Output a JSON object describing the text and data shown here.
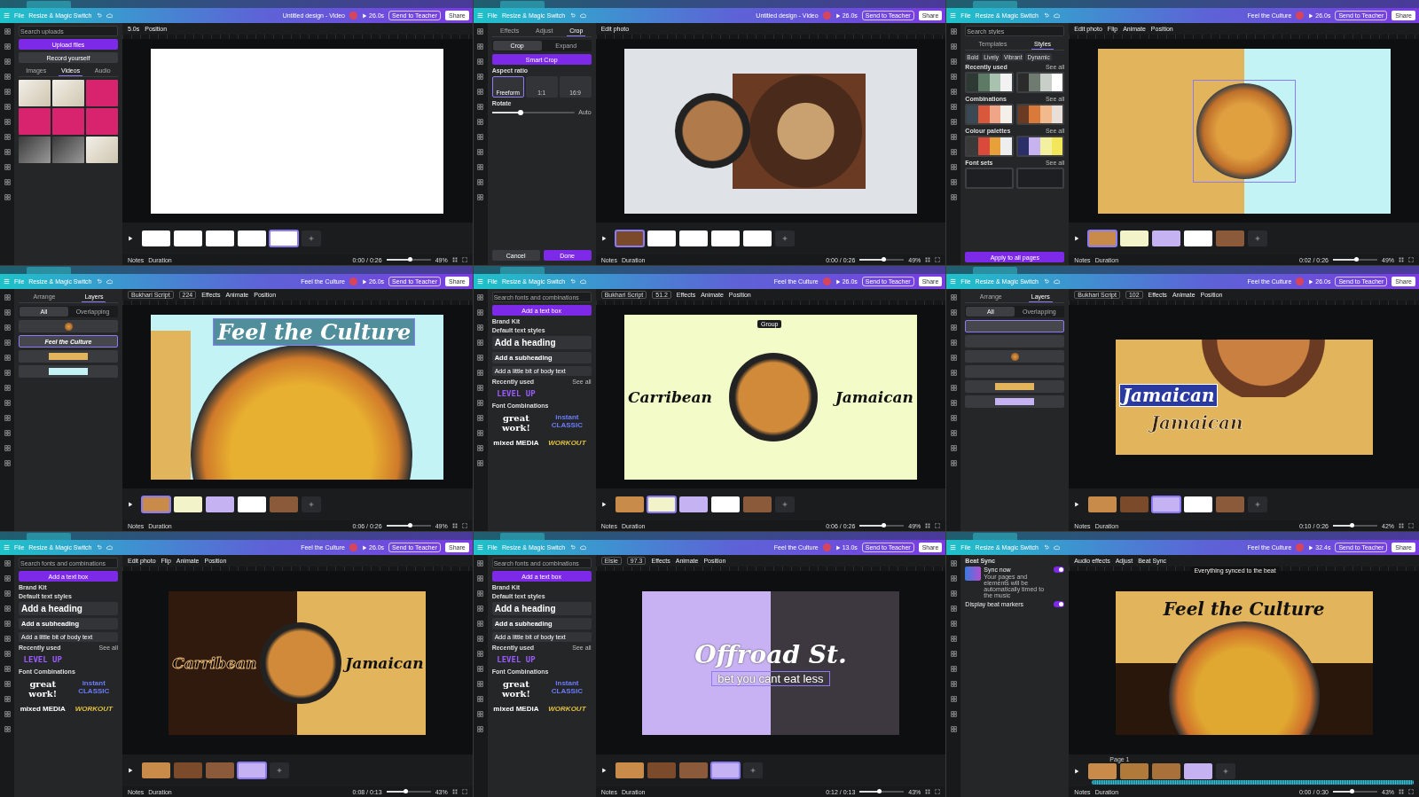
{
  "panels": [
    {
      "header": {
        "menu": "File",
        "resize": "Resize & Magic Switch",
        "title": "Untitled design - Video",
        "play": "26.0s",
        "teacher": "Send to Teacher",
        "share": "Share"
      },
      "toolbar": {
        "tools": [
          "5.0s",
          "Position"
        ]
      },
      "side": {
        "kind": "uploads",
        "placeholder": "Search uploads",
        "upload": "Upload files",
        "record": "Record yourself",
        "tabs": [
          {
            "label": "Images",
            "selected": false
          },
          {
            "label": "Videos",
            "selected": true
          },
          {
            "label": "Audio",
            "selected": false
          }
        ],
        "tiles": [
          {
            "kind": "photo"
          },
          {
            "kind": "photo"
          },
          {
            "kind": "pink"
          },
          {
            "kind": "pink"
          },
          {
            "kind": "pink"
          },
          {
            "kind": "pink"
          },
          {
            "kind": "dark"
          },
          {
            "kind": "dark"
          },
          {
            "kind": "photo"
          }
        ]
      },
      "canvas": {
        "kind": "blank",
        "bg": [
          {
            "color": "#ffffff"
          }
        ]
      },
      "thumbs": [
        {
          "color": "#ffffff",
          "selected": false
        },
        {
          "color": "#ffffff",
          "selected": false
        },
        {
          "color": "#ffffff",
          "selected": false
        },
        {
          "color": "#ffffff",
          "selected": false
        },
        {
          "color": "#ffffff",
          "selected": true
        }
      ],
      "footer": {
        "notes": "Notes",
        "duration": "Duration",
        "time": "0:00 / 0:26",
        "zoom": "49%",
        "level": 0.55
      }
    },
    {
      "header": {
        "menu": "File",
        "resize": "Resize & Magic Switch",
        "title": "Untitled design - Video",
        "play": "26.0s",
        "teacher": "Send to Teacher",
        "share": "Share"
      },
      "toolbar": {
        "tools": [
          "Edit photo"
        ]
      },
      "side": {
        "kind": "crop",
        "tabs": [
          {
            "label": "Effects",
            "selected": false
          },
          {
            "label": "Adjust",
            "selected": false
          },
          {
            "label": "Crop",
            "selected": true
          }
        ],
        "modes": [
          {
            "label": "Crop",
            "selected": true
          },
          {
            "label": "Expand",
            "selected": false
          }
        ],
        "smart": "Smart Crop",
        "aspect": "Aspect ratio",
        "ratios": [
          {
            "label": "Freeform",
            "selected": true
          },
          {
            "label": "1:1",
            "selected": false
          },
          {
            "label": "16:9",
            "selected": false
          }
        ],
        "rotate": "Rotate",
        "level": 0.35,
        "auto": "Auto",
        "cancel": "Cancel",
        "done": "Done"
      },
      "canvas": {
        "kind": "crop",
        "bg": [
          {
            "color": "#dfe2e7"
          }
        ]
      },
      "thumbs": [
        {
          "color": "#7a4a2a",
          "selected": true
        },
        {
          "color": "#ffffff",
          "selected": false
        },
        {
          "color": "#ffffff",
          "selected": false
        },
        {
          "color": "#ffffff",
          "selected": false
        },
        {
          "color": "#ffffff",
          "selected": false
        }
      ],
      "footer": {
        "notes": "Notes",
        "duration": "Duration",
        "time": "0:00 / 0:26",
        "zoom": "49%",
        "level": 0.55
      }
    },
    {
      "header": {
        "menu": "File",
        "resize": "Resize & Magic Switch",
        "title": "Feel the Culture",
        "play": "26.0s",
        "teacher": "Send to Teacher",
        "share": "Share"
      },
      "toolbar": {
        "tools": [
          "Edit photo",
          "Flip",
          "Animate",
          "Position"
        ]
      },
      "side": {
        "kind": "styles",
        "placeholder": "Search styles",
        "tabs": [
          {
            "label": "Templates",
            "selected": false
          },
          {
            "label": "Styles",
            "selected": true
          }
        ],
        "chips": [
          "Bold",
          "Lively",
          "Vibrant",
          "Dynamic"
        ],
        "sections": [
          {
            "title": "Recently used",
            "see": "See all",
            "cards": [
              {
                "stripes": [
                  {
                    "color": "#2d3a33"
                  },
                  {
                    "color": "#5c7a66"
                  },
                  {
                    "color": "#a9c2b0"
                  },
                  {
                    "color": "#f2f2f2"
                  }
                ]
              },
              {
                "stripes": [
                  {
                    "color": "#2b2b2b"
                  },
                  {
                    "color": "#6f7a70"
                  },
                  {
                    "color": "#c8cfc9"
                  },
                  {
                    "color": "#ffffff"
                  }
                ]
              }
            ]
          },
          {
            "title": "Combinations",
            "see": "See all",
            "cards": [
              {
                "stripes": [
                  {
                    "color": "#3a4a55"
                  },
                  {
                    "color": "#d9573b"
                  },
                  {
                    "color": "#f0a686"
                  },
                  {
                    "color": "#f4efe9"
                  }
                ]
              },
              {
                "stripes": [
                  {
                    "color": "#6b3a22"
                  },
                  {
                    "color": "#d97a3a"
                  },
                  {
                    "color": "#f2b98c"
                  },
                  {
                    "color": "#e8e0d8"
                  }
                ]
              }
            ]
          },
          {
            "title": "Colour palettes",
            "see": "See all",
            "cards": [
              {
                "stripes": [
                  {
                    "color": "#3a3a3a"
                  },
                  {
                    "color": "#d94a3a"
                  },
                  {
                    "color": "#e8a03a"
                  },
                  {
                    "color": "#eeeeee"
                  }
                ]
              },
              {
                "stripes": [
                  {
                    "color": "#2a2f6a"
                  },
                  {
                    "color": "#c6b3ef"
                  },
                  {
                    "color": "#f3f1a0"
                  },
                  {
                    "color": "#f2e65a"
                  }
                ]
              }
            ]
          },
          {
            "title": "Font sets",
            "see": "See all",
            "cards": [
              {
                "stripes": [
                  {
                    "color": "#1e1f22"
                  }
                ]
              },
              {
                "stripes": [
                  {
                    "color": "#1e1f22"
                  }
                ]
              }
            ]
          }
        ],
        "apply": "Apply to all pages"
      },
      "canvas": {
        "kind": "split",
        "bg": [
          {
            "color": "#e2b55c"
          },
          {
            "color": "#c3f3f5"
          }
        ]
      },
      "thumbs": [
        {
          "color": "#c98b4a",
          "selected": true
        },
        {
          "color": "#f3f3c9",
          "selected": false
        },
        {
          "color": "#c5b2f2",
          "selected": false
        },
        {
          "color": "#ffffff",
          "selected": false
        },
        {
          "color": "#8a5a3a",
          "selected": false
        }
      ],
      "footer": {
        "notes": "Notes",
        "duration": "Duration",
        "time": "0:02 / 0:26",
        "zoom": "49%",
        "level": 0.55
      }
    },
    {
      "header": {
        "menu": "File",
        "resize": "Resize & Magic Switch",
        "title": "Feel the Culture",
        "play": "26.0s",
        "teacher": "Send to Teacher",
        "share": "Share"
      },
      "toolbar": {
        "font": "Bukhari Script",
        "size": "224",
        "tools": [
          "Effects",
          "Animate",
          "Position"
        ]
      },
      "side": {
        "kind": "layers",
        "tabs": [
          {
            "label": "Arrange",
            "selected": false
          },
          {
            "label": "Layers",
            "selected": true
          }
        ],
        "filters": [
          {
            "label": "All",
            "selected": true
          },
          {
            "label": "Overlapping",
            "selected": false
          }
        ],
        "layers": [
          {
            "kind": "image",
            "selected": false
          },
          {
            "kind": "text",
            "text": "Feel the Culture",
            "selected": true
          },
          {
            "kind": "color",
            "color": "#e2b55c",
            "selected": false
          },
          {
            "kind": "color",
            "color": "#c3f3f5",
            "selected": false
          }
        ]
      },
      "canvas": {
        "kind": "banner",
        "bg": [
          {
            "color": "#c3f3f5"
          },
          {
            "color": "#e2b55c"
          }
        ],
        "texts": [
          "Feel the Culture"
        ]
      },
      "thumbs": [
        {
          "color": "#c98b4a",
          "selected": true
        },
        {
          "color": "#f3f3c9",
          "selected": false
        },
        {
          "color": "#c5b2f2",
          "selected": false
        },
        {
          "color": "#ffffff",
          "selected": false
        },
        {
          "color": "#8a5a3a",
          "selected": false
        }
      ],
      "footer": {
        "notes": "Notes",
        "duration": "Duration",
        "time": "0:06 / 0:26",
        "zoom": "49%",
        "level": 0.55
      }
    },
    {
      "header": {
        "menu": "File",
        "resize": "Resize & Magic Switch",
        "title": "Feel the Culture",
        "play": "26.0s",
        "teacher": "Send to Teacher",
        "share": "Share"
      },
      "toolbar": {
        "font": "Bukhari Script",
        "size": "51.2",
        "tools": [
          "Effects",
          "Animate",
          "Position"
        ]
      },
      "side": {
        "kind": "text",
        "placeholder": "Search fonts and combinations",
        "add": "Add a text box",
        "brand": "Brand Kit",
        "defaults": "Default text styles",
        "heading": "Add a heading",
        "subheading": "Add a subheading",
        "body": "Add a little bit of body text",
        "recent": "Recently used",
        "see": "See all",
        "recents": [
          {
            "kind": "level",
            "text": "LEVEL UP"
          }
        ],
        "combos_title": "Font Combinations",
        "combos": [
          {
            "kind": "great",
            "text": "great work!"
          },
          {
            "kind": "instant",
            "text": "instant CLASSIC"
          },
          {
            "kind": "mixed",
            "text": "mixed MEDIA"
          },
          {
            "kind": "workout",
            "text": "WORKOUT"
          }
        ]
      },
      "canvas": {
        "kind": "trio",
        "bg": [
          {
            "color": "#f3fbc8"
          }
        ],
        "texts": [
          "Carribean",
          "Jamaican",
          "Group"
        ]
      },
      "thumbs": [
        {
          "color": "#c98b4a",
          "selected": false
        },
        {
          "color": "#f3f3c9",
          "selected": true
        },
        {
          "color": "#c5b2f2",
          "selected": false
        },
        {
          "color": "#ffffff",
          "selected": false
        },
        {
          "color": "#8a5a3a",
          "selected": false
        }
      ],
      "footer": {
        "notes": "Notes",
        "duration": "Duration",
        "time": "0:06 / 0:26",
        "zoom": "49%",
        "level": 0.55
      }
    },
    {
      "header": {
        "menu": "File",
        "resize": "Resize & Magic Switch",
        "title": "Feel the Culture",
        "play": "26.0s",
        "teacher": "Send to Teacher",
        "share": "Share"
      },
      "toolbar": {
        "font": "Bukhari Script",
        "size": "102",
        "tools": [
          "Effects",
          "Animate",
          "Position"
        ]
      },
      "side": {
        "kind": "layers",
        "tabs": [
          {
            "label": "Arrange",
            "selected": false
          },
          {
            "label": "Layers",
            "selected": true
          }
        ],
        "filters": [
          {
            "label": "All",
            "selected": true
          },
          {
            "label": "Overlapping",
            "selected": false
          }
        ],
        "layers": [
          {
            "kind": "blank",
            "selected": true
          },
          {
            "kind": "blank",
            "selected": false
          },
          {
            "kind": "image",
            "selected": false
          },
          {
            "kind": "blank",
            "selected": false
          },
          {
            "kind": "color",
            "color": "#e2b55c",
            "selected": false
          },
          {
            "kind": "color",
            "color": "#c5b2f2",
            "selected": false
          }
        ]
      },
      "canvas": {
        "kind": "jamaican",
        "bg": [
          {
            "color": "#e2b55c"
          }
        ],
        "texts": [
          "Jamaican",
          "Jamaican"
        ]
      },
      "thumbs": [
        {
          "color": "#c98b4a",
          "selected": false
        },
        {
          "color": "#7a4a2a",
          "selected": false
        },
        {
          "color": "#c5b2f2",
          "selected": true
        },
        {
          "color": "#ffffff",
          "selected": false
        },
        {
          "color": "#8a5a3a",
          "selected": false
        }
      ],
      "footer": {
        "notes": "Notes",
        "duration": "Duration",
        "time": "0:10 / 0:26",
        "zoom": "42%",
        "level": 0.45
      }
    },
    {
      "header": {
        "menu": "File",
        "resize": "Resize & Magic Switch",
        "title": "Feel the Culture",
        "play": "26.0s",
        "teacher": "Send to Teacher",
        "share": "Share"
      },
      "toolbar": {
        "tools": [
          "Edit photo",
          "Flip",
          "Animate",
          "Position"
        ]
      },
      "side": {
        "kind": "text",
        "placeholder": "Search fonts and combinations",
        "add": "Add a text box",
        "brand": "Brand Kit",
        "defaults": "Default text styles",
        "heading": "Add a heading",
        "subheading": "Add a subheading",
        "body": "Add a little bit of body text",
        "recent": "Recently used",
        "see": "See all",
        "recents": [
          {
            "kind": "level",
            "text": "LEVEL UP"
          }
        ],
        "combos_title": "Font Combinations",
        "combos": [
          {
            "kind": "great",
            "text": "great work!"
          },
          {
            "kind": "instant",
            "text": "instant CLASSIC"
          },
          {
            "kind": "mixed",
            "text": "mixed MEDIA"
          },
          {
            "kind": "workout",
            "text": "WORKOUT"
          }
        ]
      },
      "canvas": {
        "kind": "split-trio",
        "bg": [
          {
            "color": "#2f1a0d"
          },
          {
            "color": "#e2b55c"
          }
        ],
        "texts": [
          "Carribean",
          "Jamaican"
        ]
      },
      "thumbs": [
        {
          "color": "#c98b4a",
          "selected": false
        },
        {
          "color": "#7a4a2a",
          "selected": false
        },
        {
          "color": "#8a5a3a",
          "selected": false
        },
        {
          "color": "#c5b2f2",
          "selected": true
        }
      ],
      "footer": {
        "notes": "Notes",
        "duration": "Duration",
        "time": "0:08 / 0:13",
        "zoom": "43%",
        "level": 0.45
      }
    },
    {
      "header": {
        "menu": "File",
        "resize": "Resize & Magic Switch",
        "title": "Feel the Culture",
        "play": "13.0s",
        "teacher": "Send to Teacher",
        "share": "Share"
      },
      "toolbar": {
        "font": "Elsie",
        "size": "97.3",
        "tools": [
          "Effects",
          "Animate",
          "Position"
        ]
      },
      "side": {
        "kind": "text",
        "placeholder": "Search fonts and combinations",
        "add": "Add a text box",
        "brand": "Brand Kit",
        "defaults": "Default text styles",
        "heading": "Add a heading",
        "subheading": "Add a subheading",
        "body": "Add a little bit of body text",
        "recent": "Recently used",
        "see": "See all",
        "recents": [
          {
            "kind": "level",
            "text": "LEVEL UP"
          }
        ],
        "combos_title": "Font Combinations",
        "combos": [
          {
            "kind": "great",
            "text": "great work!"
          },
          {
            "kind": "instant",
            "text": "instant CLASSIC"
          },
          {
            "kind": "mixed",
            "text": "mixed MEDIA"
          },
          {
            "kind": "workout",
            "text": "WORKOUT"
          }
        ]
      },
      "canvas": {
        "kind": "offroad",
        "bg": [
          {
            "color": "#c8b2f4"
          },
          {
            "color": "#3d3840"
          }
        ],
        "texts": [
          "Offroad St.",
          "bet you cant eat less"
        ]
      },
      "thumbs": [
        {
          "color": "#c98b4a",
          "selected": false
        },
        {
          "color": "#7a4a2a",
          "selected": false
        },
        {
          "color": "#8a5a3a",
          "selected": false
        },
        {
          "color": "#c5b2f2",
          "selected": true
        }
      ],
      "footer": {
        "notes": "Notes",
        "duration": "Duration",
        "time": "0:12 / 0:13",
        "zoom": "43%",
        "level": 0.45
      }
    },
    {
      "header": {
        "menu": "File",
        "resize": "Resize & Magic Switch",
        "title": "Feel the Culture",
        "play": "32.4s",
        "teacher": "Send to Teacher",
        "share": "Share"
      },
      "toolbar": {
        "tools": [
          "Audio effects",
          "Adjust",
          "Beat Sync"
        ],
        "note": "Everything synced to the beat"
      },
      "side": {
        "kind": "beat",
        "title": "Beat Sync",
        "items": [
          {
            "title": "Sync now",
            "desc": "Your pages and elements will be automatically timed to the music",
            "on": true,
            "art": true
          },
          {
            "title": "Display beat markers",
            "on": true,
            "art": false
          }
        ]
      },
      "canvas": {
        "kind": "culture",
        "bg": [
          {
            "color": "#e2b55c"
          },
          {
            "color": "#2a170c"
          }
        ],
        "texts": [
          "Feel the Culture"
        ]
      },
      "page": "Page 1",
      "thumbs": [
        {
          "color": "#c98b4a",
          "selected": false
        },
        {
          "color": "#b07a3a",
          "selected": false
        },
        {
          "color": "#a8703a",
          "selected": false
        },
        {
          "color": "#c5b2f2",
          "selected": false
        }
      ],
      "footer": {
        "notes": "Notes",
        "duration": "Duration",
        "time": "0:00 / 0:30",
        "zoom": "43%",
        "level": 0.45
      }
    }
  ]
}
